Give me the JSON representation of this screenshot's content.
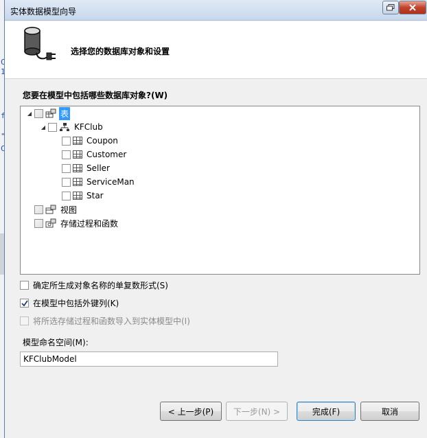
{
  "window": {
    "title": "实体数据模型向导"
  },
  "header": {
    "title": "选择您的数据库对象和设置"
  },
  "prompt": "您要在模型中包括哪些数据库对象?(W)",
  "tree": {
    "tables_label": "表",
    "db_label": "KFClub",
    "tables": [
      "Coupon",
      "Customer",
      "Seller",
      "ServiceMan",
      "Star"
    ],
    "views_label": "视图",
    "procs_label": "存储过程和函数"
  },
  "options": {
    "pluralize": {
      "label": "确定所生成对象名称的单复数形式(S)",
      "checked": false
    },
    "foreign_keys": {
      "label": "在模型中包括外键列(K)",
      "checked": true
    },
    "import_procs": {
      "label": "将所选存储过程和函数导入到实体模型中(I)",
      "checked": false,
      "disabled": true
    }
  },
  "namespace": {
    "label": "模型命名空间(M):",
    "value": "KFClubModel"
  },
  "buttons": {
    "prev": "< 上一步(P)",
    "next": "下一步(N) >",
    "finish": "完成(F)",
    "cancel": "取消"
  },
  "colors": {
    "selection": "#3399ff",
    "close_button": "#c2432c"
  }
}
